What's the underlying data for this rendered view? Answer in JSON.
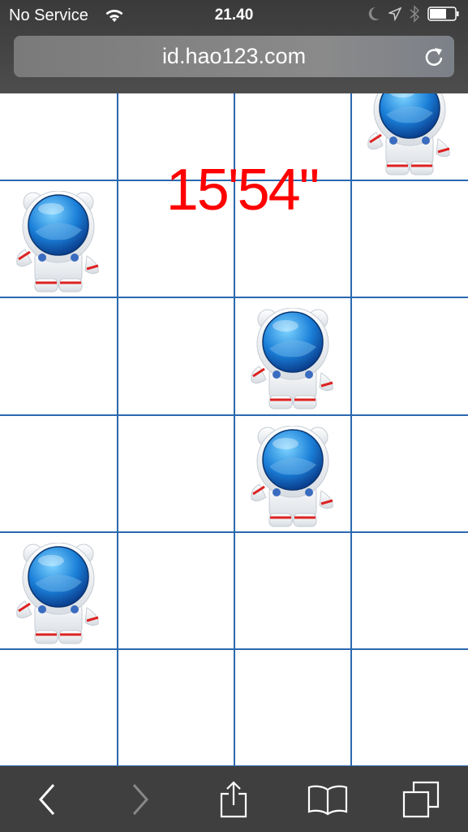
{
  "status_bar": {
    "carrier": "No Service",
    "time": "21.40",
    "battery_percent": 60,
    "icons": [
      "wifi-icon",
      "moon-icon",
      "location-icon",
      "bluetooth-icon",
      "battery-icon"
    ]
  },
  "browser": {
    "url": "id.hao123.com"
  },
  "game": {
    "timer": "15'54\"",
    "columns": 4,
    "rows": [
      [
        false,
        false,
        false,
        true
      ],
      [
        true,
        false,
        false,
        false
      ],
      [
        false,
        false,
        true,
        false
      ],
      [
        false,
        false,
        true,
        false
      ],
      [
        true,
        false,
        false,
        false
      ],
      [
        false,
        false,
        false,
        false
      ]
    ],
    "line_color": "#2b68b0",
    "timer_color": "#ff0000"
  },
  "toolbar": [
    "back-icon",
    "forward-icon",
    "share-icon",
    "bookmarks-icon",
    "tabs-icon"
  ]
}
